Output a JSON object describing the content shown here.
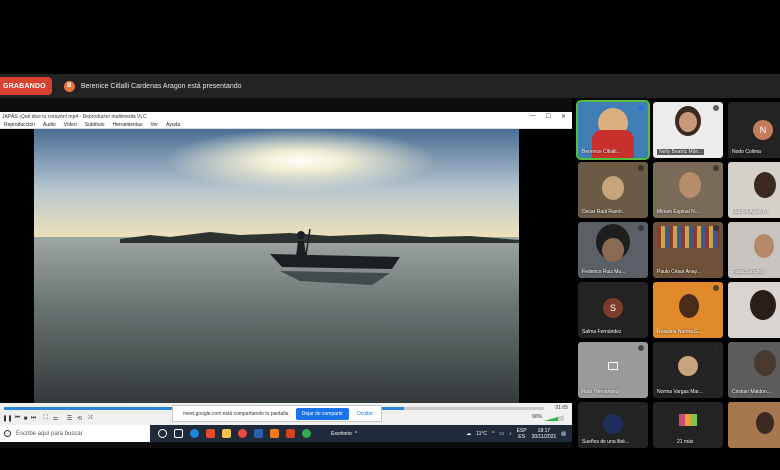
{
  "zoom": {
    "recording_label": "GRABANDO",
    "presenter_initial": "B",
    "presenter_text": "Berenice Citlalli Cardenas Aragon está presentando"
  },
  "vlc": {
    "title": "JAPÁS ¡Qué dice tu corazón!.mp4 - Reproductor multimedia VLC",
    "menu": [
      "Reproducción",
      "Audio",
      "Vídeo",
      "Subtítulo",
      "Herramientas",
      "Ver",
      "Ayuda"
    ],
    "progress": 0.74,
    "time": "01:05",
    "volume_label": "90%"
  },
  "share_notice": {
    "text": "meet.google.com está compartiendo tu pantalla.",
    "stop_label": "Dejar de compartir",
    "hide_label": "Ocultar"
  },
  "taskbar": {
    "search_placeholder": "Escribe aquí para buscar",
    "app_label": "Escritorio",
    "temperature": "11°C",
    "language": "ESP",
    "language_sub": "ES",
    "time": "18:17",
    "date": "20/11/2021"
  },
  "gallery": {
    "tiles": [
      {
        "name": "Berenice Citlalli...",
        "avatar": ""
      },
      {
        "name": "Nelly Beatriz Món...",
        "avatar": ""
      },
      {
        "name": "Nodo Colima",
        "avatar": "N"
      },
      {
        "name": "Oscar Raúl Ramír...",
        "avatar": ""
      },
      {
        "name": "Miriam Espinal N...",
        "avatar": ""
      },
      {
        "name": "Maricel Ayala A...",
        "avatar": ""
      },
      {
        "name": "Federico Ruiz Mu...",
        "avatar": ""
      },
      {
        "name": "Paulo César Anay...",
        "avatar": ""
      },
      {
        "name": "Rosa Sánchez",
        "avatar": ""
      },
      {
        "name": "Salma Fernández",
        "avatar": "S"
      },
      {
        "name": "Rosalina Norma G...",
        "avatar": ""
      },
      {
        "name": "",
        "avatar": ""
      },
      {
        "name": "Rubí Hernández",
        "avatar": ""
      },
      {
        "name": "Norma Vargas Mar...",
        "avatar": ""
      },
      {
        "name": "Cristian Maldon...",
        "avatar": ""
      },
      {
        "name": "Sueños de una libé...",
        "avatar": ""
      },
      {
        "name": "21 más",
        "avatar": ""
      },
      {
        "name": "",
        "avatar": ""
      }
    ]
  }
}
